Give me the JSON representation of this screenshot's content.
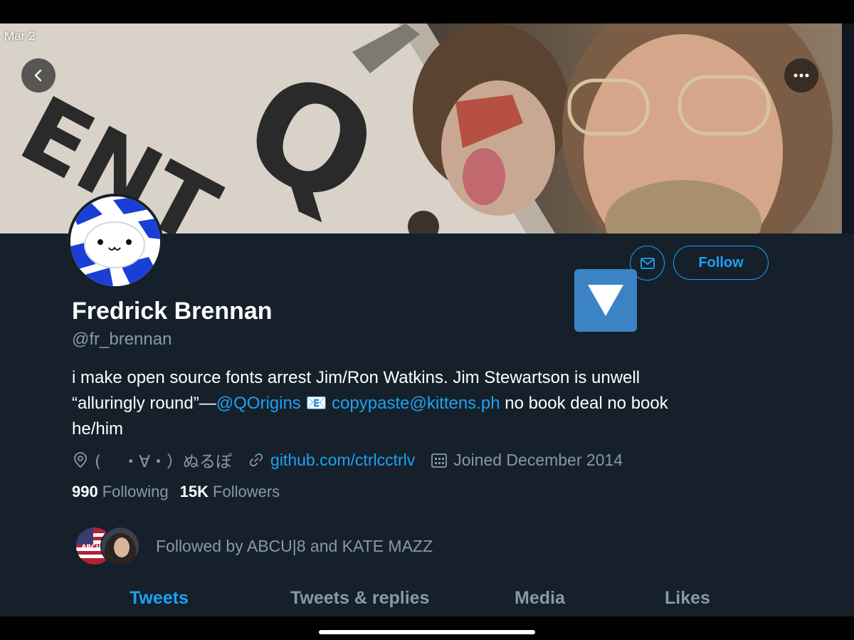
{
  "status": {
    "date": "Mar 2"
  },
  "header": {
    "back_icon": "chevron-left-icon",
    "more_icon": "ellipsis-icon"
  },
  "profile": {
    "name": "Fredrick Brennan",
    "handle": "@fr_brennan",
    "message_icon": "envelope-icon",
    "follow_label": "Follow",
    "bio": {
      "line1": "i make open source fonts arrest Jim/Ron Watkins. Jim Stewartson is unwell",
      "line2_prefix": "“alluringly round”—",
      "mention": "@QOrigins",
      "email_emoji": "📧",
      "email": "copypaste@kittens.ph",
      "line2_suffix": " no book deal no book",
      "line3": "he/him"
    },
    "location": "(　 ・∀・）ぬるぽ",
    "website": "github.com/ctrlcctrlv",
    "joined": "Joined December 2014",
    "following_count": "990",
    "following_label": "Following",
    "followers_count": "15K",
    "followers_label": "Followers",
    "followed_by": "Followed by ABCU|8 and KATE MAZZ",
    "follower_avatar_text": "ABCU|8"
  },
  "tabs": [
    {
      "label": "Tweets",
      "active": true
    },
    {
      "label": "Tweets & replies",
      "active": false
    },
    {
      "label": "Media",
      "active": false
    },
    {
      "label": "Likes",
      "active": false
    }
  ],
  "colors": {
    "background": "#15202b",
    "accent": "#1da1f2",
    "secondary_text": "#8899a6",
    "overlay_button": "#3b83c4"
  }
}
